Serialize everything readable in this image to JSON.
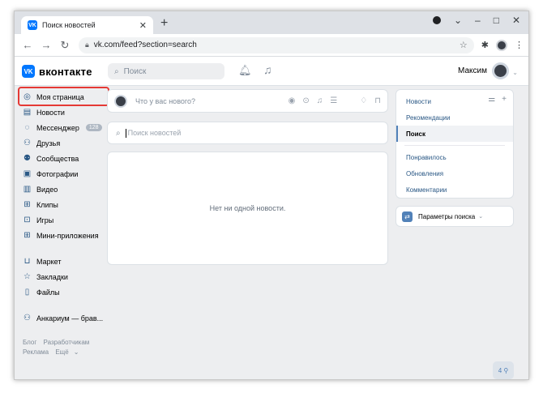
{
  "browser": {
    "tab_title": "Поиск новостей",
    "tab_favicon": "VK",
    "url": "vk.com/feed?section=search"
  },
  "header": {
    "logo_mark": "VK",
    "logo_text": "вконтакте",
    "search_placeholder": "Поиск",
    "user_name": "Максим"
  },
  "leftnav": {
    "items": [
      {
        "label": "Моя страница",
        "icon": "user-circle-icon"
      },
      {
        "label": "Новости",
        "icon": "news-icon"
      },
      {
        "label": "Мессенджер",
        "icon": "chat-icon",
        "badge": "128"
      },
      {
        "label": "Друзья",
        "icon": "friends-icon"
      },
      {
        "label": "Сообщества",
        "icon": "communities-icon"
      },
      {
        "label": "Фотографии",
        "icon": "photo-icon"
      },
      {
        "label": "Видео",
        "icon": "video-icon"
      },
      {
        "label": "Клипы",
        "icon": "clips-icon"
      },
      {
        "label": "Игры",
        "icon": "gamepad-icon"
      },
      {
        "label": "Мини-приложения",
        "icon": "apps-icon"
      },
      {
        "label": "Маркет",
        "icon": "market-icon"
      },
      {
        "label": "Закладки",
        "icon": "bookmark-icon"
      },
      {
        "label": "Файлы",
        "icon": "file-icon"
      },
      {
        "label": "Анкариум — брав...",
        "icon": "group-icon"
      }
    ],
    "footer": [
      "Блог",
      "Разработчикам",
      "Реклама",
      "Ещё"
    ]
  },
  "composer": {
    "placeholder": "Что у вас нового?"
  },
  "news_search": {
    "placeholder": "Поиск новостей"
  },
  "feed": {
    "empty_text": "Нет ни одной новости."
  },
  "rightmenu": {
    "items": [
      "Новости",
      "Рекомендации",
      "Поиск",
      "Понравилось",
      "Обновления",
      "Комментарии"
    ],
    "active": "Поиск"
  },
  "params": {
    "label": "Параметры поиска"
  },
  "online": {
    "count": "4"
  }
}
